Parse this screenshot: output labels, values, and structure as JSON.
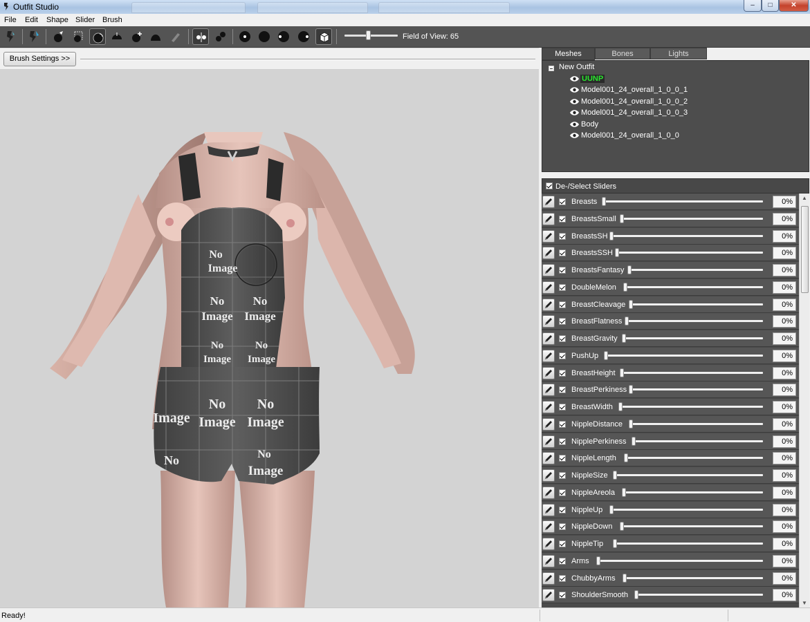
{
  "window": {
    "title": "Outfit Studio",
    "minimize": "–",
    "maximize": "□",
    "close": "✕"
  },
  "menu": [
    "File",
    "Edit",
    "Shape",
    "Slider",
    "Brush"
  ],
  "toolbar": {
    "tools": [
      "select-icon",
      "transform-icon",
      "mask-brush-icon",
      "inflate-brush-icon",
      "deflate-brush-icon",
      "move-brush-icon",
      "smooth-brush-icon",
      "weight-brush-icon",
      "paint-brush-icon",
      "mirror-toggle-icon",
      "vertex-toggle-icon",
      "brush-size-small-icon",
      "brush-size-large-icon",
      "brush-strength-icon",
      "brush-falloff-icon",
      "cube-view-icon"
    ],
    "field_of_view": 65,
    "fov_label": "Field of View: 65"
  },
  "brush_settings": {
    "label": "Brush Settings >>"
  },
  "tabs": [
    {
      "label": "Meshes",
      "active": true
    },
    {
      "label": "Bones",
      "active": false
    },
    {
      "label": "Lights",
      "active": false
    }
  ],
  "mesh_tree": {
    "root": "New Outfit",
    "items": [
      {
        "label": "UUNP",
        "selected": true
      },
      {
        "label": "Model001_24_overall_1_0_0_1",
        "selected": false
      },
      {
        "label": "Model001_24_overall_1_0_0_2",
        "selected": false
      },
      {
        "label": "Model001_24_overall_1_0_0_3",
        "selected": false
      },
      {
        "label": "Body",
        "selected": false
      },
      {
        "label": "Model001_24_overall_1_0_0",
        "selected": false
      }
    ]
  },
  "sliders_header": {
    "label": "De-/Select Sliders",
    "checked": true
  },
  "sliders": [
    {
      "name": "Breasts",
      "value": "0%"
    },
    {
      "name": "BreastsSmall",
      "value": "0%"
    },
    {
      "name": "BreastsSH",
      "value": "0%"
    },
    {
      "name": "BreastsSSH",
      "value": "0%"
    },
    {
      "name": "BreastsFantasy",
      "value": "0%"
    },
    {
      "name": "DoubleMelon",
      "value": "0%"
    },
    {
      "name": "BreastCleavage",
      "value": "0%"
    },
    {
      "name": "BreastFlatness",
      "value": "0%"
    },
    {
      "name": "BreastGravity",
      "value": "0%"
    },
    {
      "name": "PushUp",
      "value": "0%"
    },
    {
      "name": "BreastHeight",
      "value": "0%"
    },
    {
      "name": "BreastPerkiness",
      "value": "0%"
    },
    {
      "name": "BreastWidth",
      "value": "0%"
    },
    {
      "name": "NippleDistance",
      "value": "0%"
    },
    {
      "name": "NipplePerkiness",
      "value": "0%"
    },
    {
      "name": "NippleLength",
      "value": "0%"
    },
    {
      "name": "NippleSize",
      "value": "0%"
    },
    {
      "name": "NippleAreola",
      "value": "0%"
    },
    {
      "name": "NippleUp",
      "value": "0%"
    },
    {
      "name": "NippleDown",
      "value": "0%"
    },
    {
      "name": "NippleTip",
      "value": "0%"
    },
    {
      "name": "Arms",
      "value": "0%"
    },
    {
      "name": "ChubbyArms",
      "value": "0%"
    },
    {
      "name": "ShoulderSmooth",
      "value": "0%"
    }
  ],
  "status": {
    "text": "Ready!"
  },
  "viewport": {
    "texture_text": [
      "No",
      "Image"
    ]
  }
}
